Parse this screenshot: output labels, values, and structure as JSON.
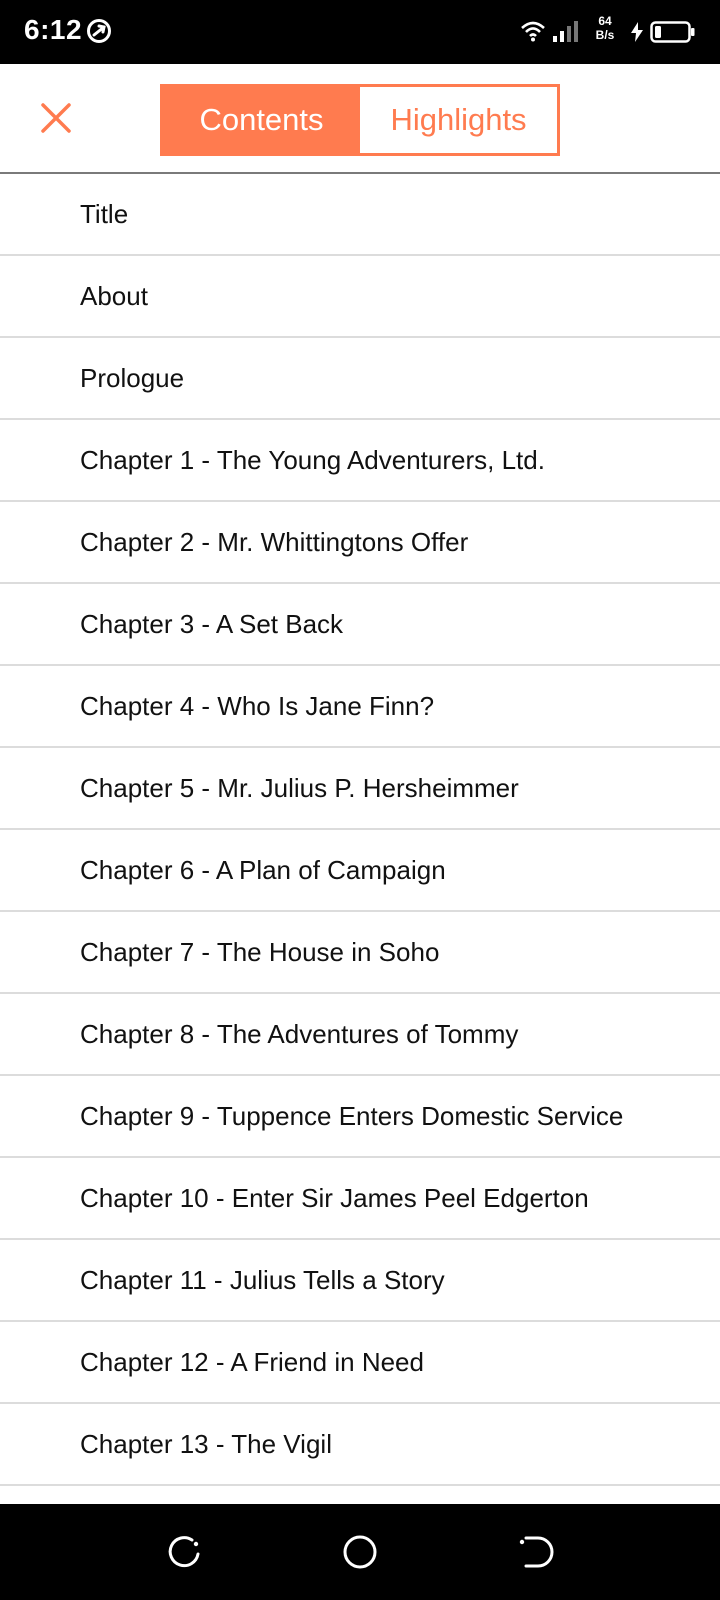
{
  "status_bar": {
    "time": "6:12",
    "net_speed_value": "64",
    "net_speed_unit": "B/s"
  },
  "header": {
    "close_icon": "close-icon",
    "tabs": [
      {
        "label": "Contents",
        "active": true
      },
      {
        "label": "Highlights",
        "active": false
      }
    ],
    "accent_color": "#ff7b4f"
  },
  "toc": {
    "items": [
      {
        "label": "Title"
      },
      {
        "label": "About"
      },
      {
        "label": "Prologue"
      },
      {
        "label": "Chapter 1 - The Young Adventurers, Ltd."
      },
      {
        "label": "Chapter 2 - Mr. Whittingtons Offer"
      },
      {
        "label": "Chapter 3 - A Set Back"
      },
      {
        "label": "Chapter 4 - Who Is Jane Finn?"
      },
      {
        "label": "Chapter 5 - Mr. Julius P. Hersheimmer"
      },
      {
        "label": "Chapter 6 - A Plan of Campaign"
      },
      {
        "label": "Chapter 7 - The House in Soho"
      },
      {
        "label": "Chapter 8 - The Adventures of Tommy"
      },
      {
        "label": "Chapter 9 - Tuppence Enters Domestic Service"
      },
      {
        "label": "Chapter 10 - Enter Sir James Peel Edgerton"
      },
      {
        "label": "Chapter 11 - Julius Tells a Story"
      },
      {
        "label": "Chapter 12 - A Friend in Need"
      },
      {
        "label": "Chapter 13 - The Vigil"
      },
      {
        "label": ""
      }
    ]
  },
  "nav_bar": {
    "buttons": [
      "back-icon",
      "home-icon",
      "recents-icon"
    ]
  }
}
